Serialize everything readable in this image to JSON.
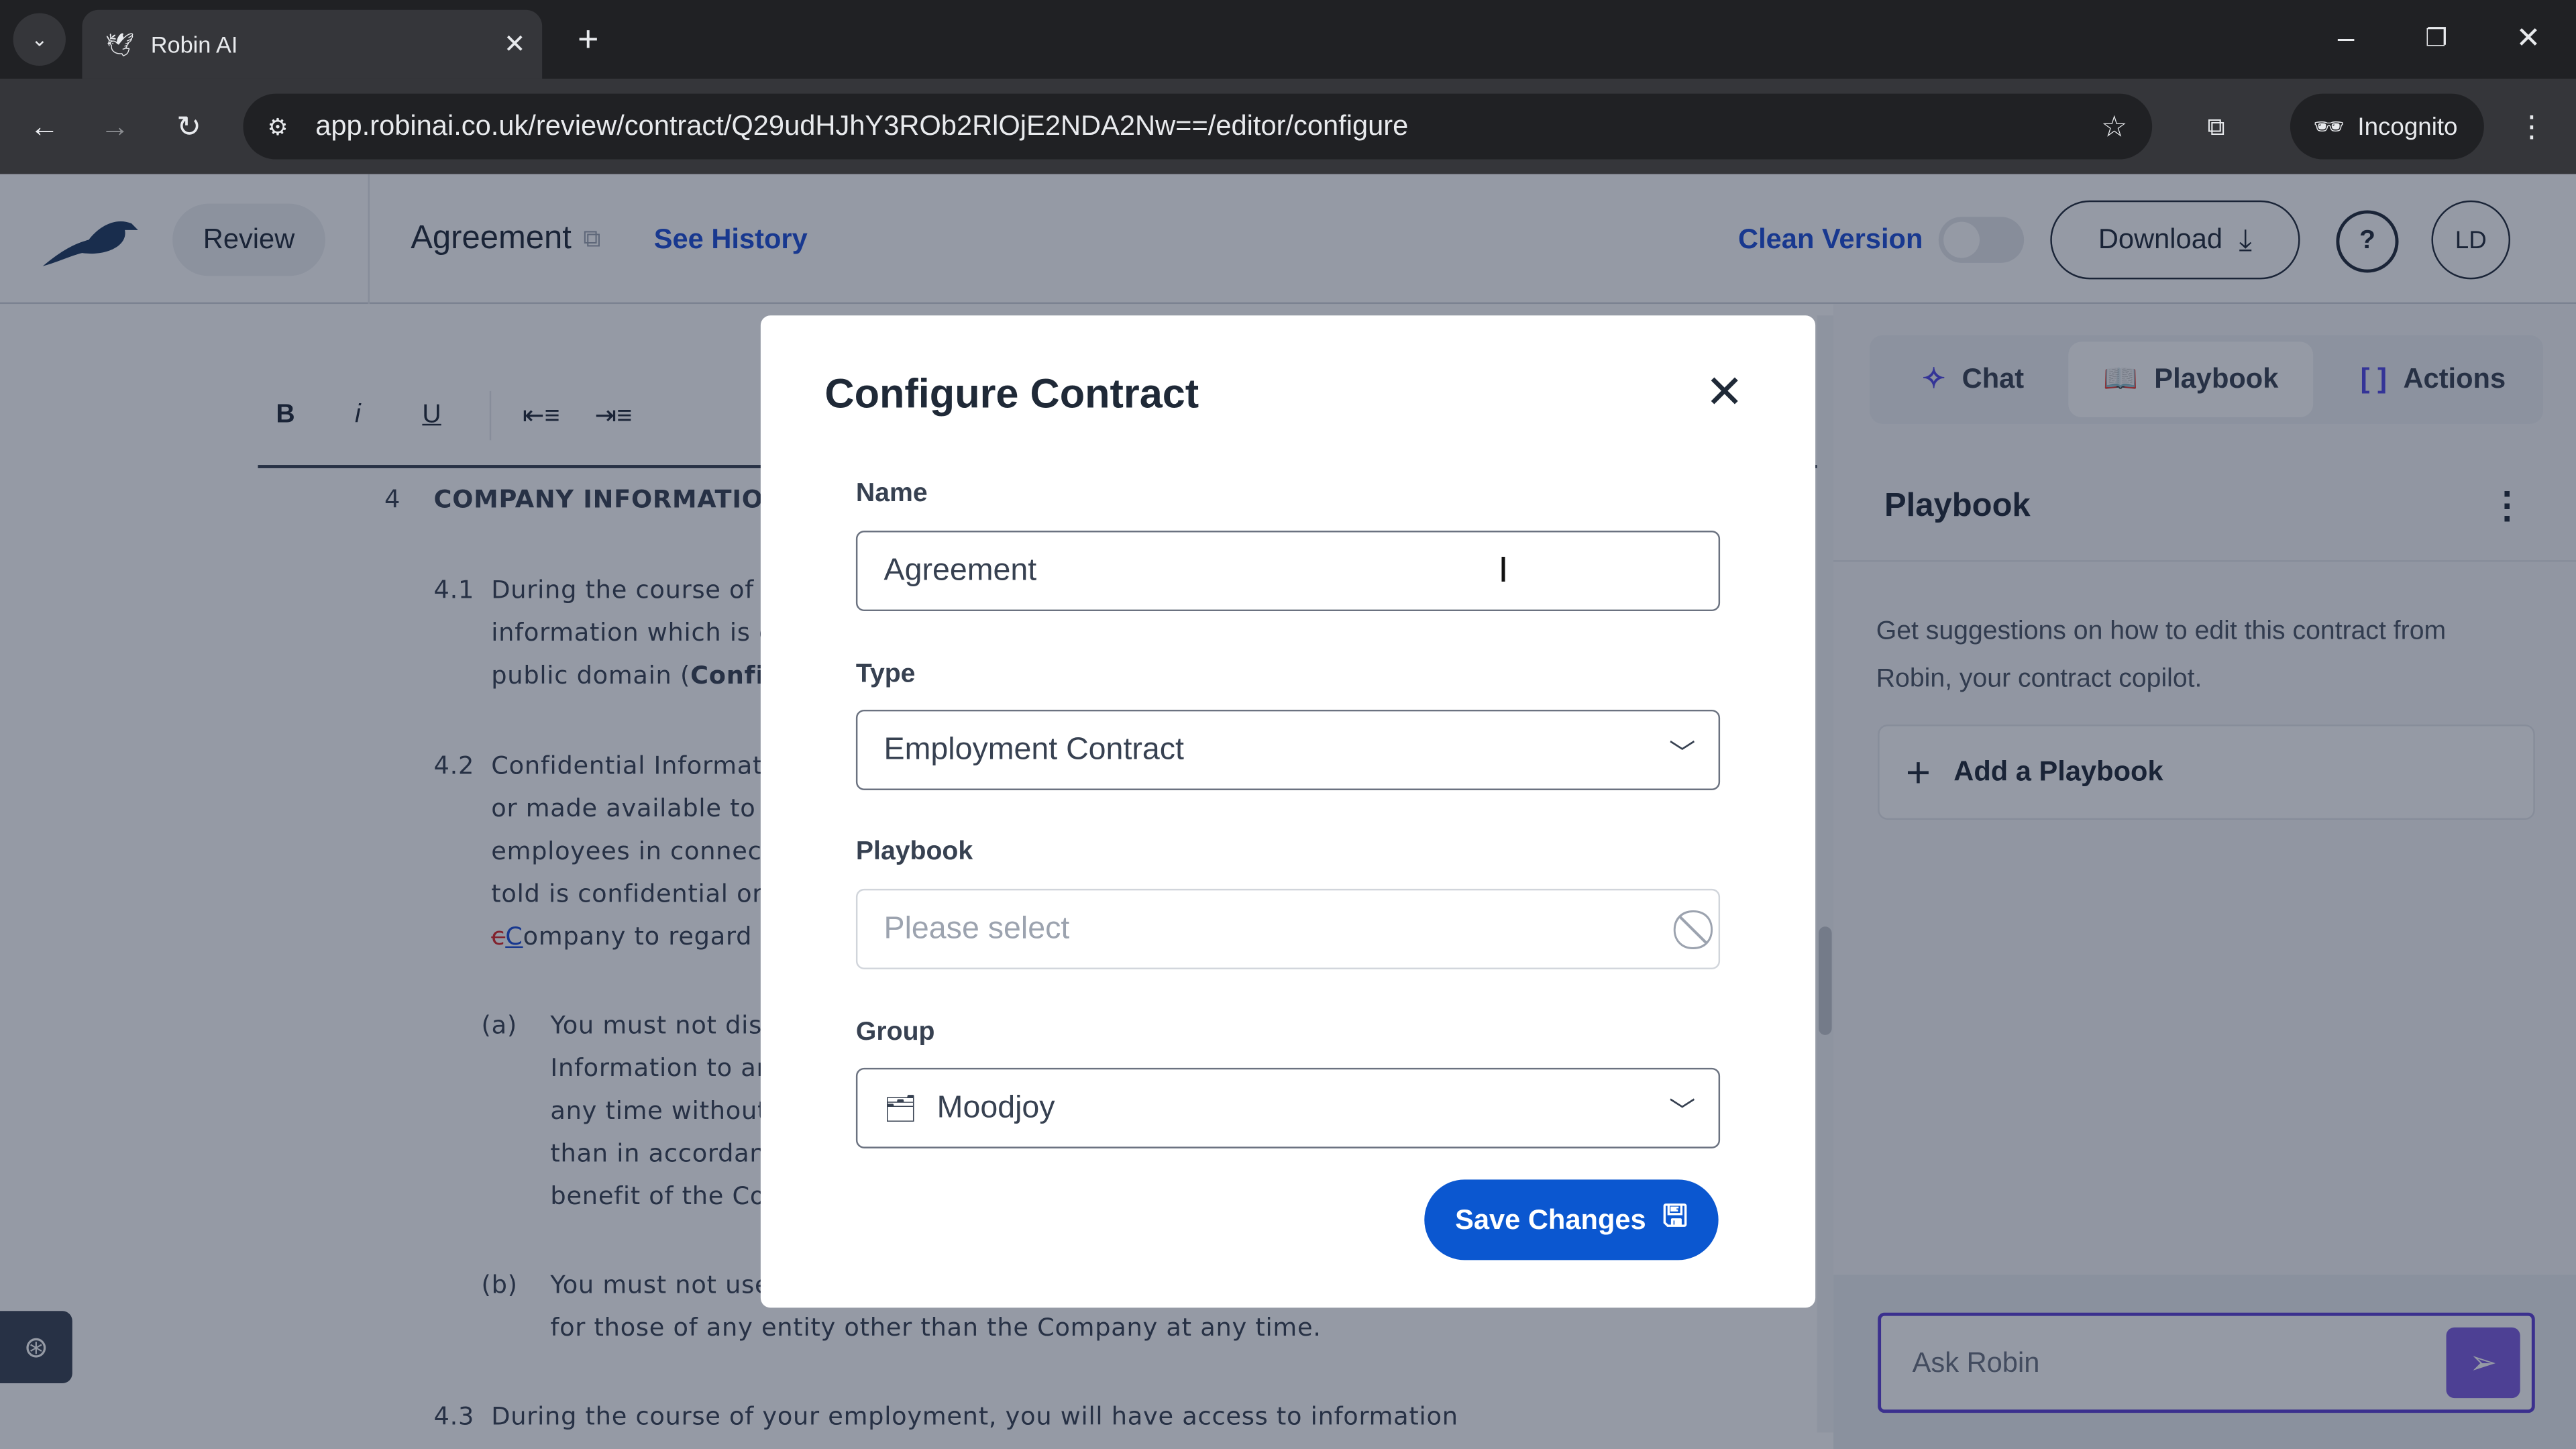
{
  "browser": {
    "tab_title": "Robin AI",
    "url": "app.robinai.co.uk/review/contract/Q29udHJhY3ROb2RlOjE2NDA2Nw==/editor/configure",
    "incognito_label": "Incognito"
  },
  "header": {
    "review_label": "Review",
    "doc_title": "Agreement",
    "see_history": "See History",
    "clean_version": "Clean Version",
    "download": "Download",
    "avatar_initials": "LD"
  },
  "toolbar": {
    "bold": "B",
    "italic": "i",
    "underline": "U"
  },
  "document": {
    "section_num": "4",
    "section_title": "COMPANY INFORMATIO",
    "p41_num": "4.1",
    "p41": [
      "During the course of y",
      "information which is c",
      "public domain ("
    ],
    "p41_bold": "Confid",
    "p42_num": "4.2",
    "p42": [
      "Confidential Informat",
      "or made available to y",
      "employees in connecti",
      "told is confidential or w"
    ],
    "p42_deleted": "c",
    "p42_inserted": "C",
    "p42_last": "ompany to regard a",
    "a_label": "(a)",
    "a_lines": [
      "You must not disc",
      "Information to an",
      "any time without",
      "than in accordanc",
      "benefit of the Co"
    ],
    "b_label": "(b)",
    "b_lines": [
      "You must not use",
      "for those of any entity other than the Company at any time."
    ],
    "p43_num": "4.3",
    "p43": "During the course of your employment, you will have access to information"
  },
  "modal": {
    "title": "Configure Contract",
    "name_label": "Name",
    "name_value": "Agreement",
    "type_label": "Type",
    "type_value": "Employment Contract",
    "playbook_label": "Playbook",
    "playbook_placeholder": "Please select",
    "group_label": "Group",
    "group_value": "Moodjoy",
    "save_label": "Save Changes"
  },
  "right_panel": {
    "tabs": [
      {
        "label": "Chat"
      },
      {
        "label": "Playbook"
      },
      {
        "label": "Actions"
      }
    ],
    "active_tab": "Playbook",
    "heading": "Playbook",
    "description": "Get suggestions on how to edit this contract from Robin, your contract copilot.",
    "add_playbook": "Add a Playbook",
    "ask_placeholder": "Ask Robin"
  },
  "colors": {
    "primary": "#0b57d0",
    "accent_purple": "#6d4fd6",
    "link": "#1d4ed8"
  }
}
